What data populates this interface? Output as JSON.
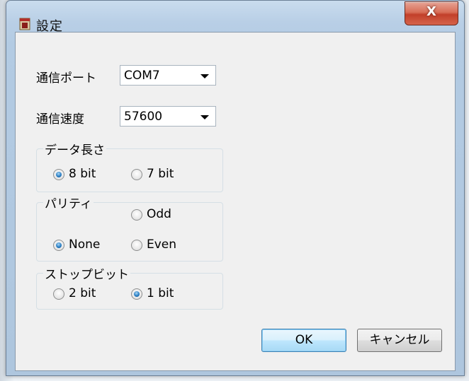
{
  "window": {
    "title": "設定",
    "close_glyph": "X"
  },
  "fields": {
    "port_label": "通信ポート",
    "port_value": "COM7",
    "speed_label": "通信速度",
    "speed_value": "57600"
  },
  "groups": {
    "data_length": {
      "title": "データ長さ",
      "options": [
        "8 bit",
        "7 bit"
      ],
      "selected": "8 bit"
    },
    "parity": {
      "title": "パリティ",
      "options": [
        "Odd",
        "None",
        "Even"
      ],
      "selected": "None"
    },
    "stop_bit": {
      "title": "ストップビット",
      "options": [
        "2 bit",
        "1 bit"
      ],
      "selected": "1 bit"
    }
  },
  "buttons": {
    "ok": "OK",
    "cancel": "キャンセル"
  },
  "colors": {
    "radio_selected": "#2a7fc4",
    "close_button": "#c2402a",
    "default_button_border": "#3c7fb1"
  }
}
